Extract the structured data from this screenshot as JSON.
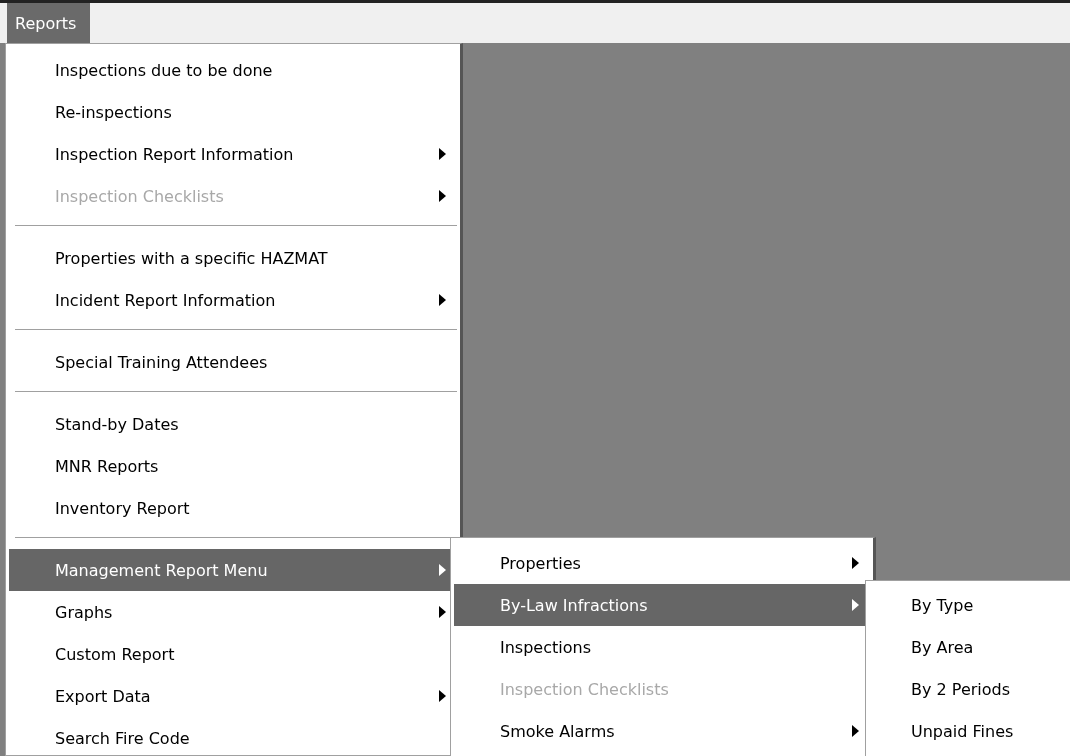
{
  "menu_bar": [
    {
      "label": "Reports",
      "selected": true
    }
  ],
  "main_menu": [
    {
      "kind": "item",
      "label": "Inspections due to be done",
      "submenu": false,
      "disabled": false,
      "selected": false
    },
    {
      "kind": "item",
      "label": "Re-inspections",
      "submenu": false,
      "disabled": false,
      "selected": false
    },
    {
      "kind": "item",
      "label": "Inspection Report Information",
      "submenu": true,
      "disabled": false,
      "selected": false
    },
    {
      "kind": "item",
      "label": "Inspection Checklists",
      "submenu": true,
      "disabled": true,
      "selected": false
    },
    {
      "kind": "separator"
    },
    {
      "kind": "item",
      "label": "Properties with a specific HAZMAT",
      "submenu": false,
      "disabled": false,
      "selected": false
    },
    {
      "kind": "item",
      "label": "Incident Report Information",
      "submenu": true,
      "disabled": false,
      "selected": false
    },
    {
      "kind": "separator"
    },
    {
      "kind": "item",
      "label": "Special Training Attendees",
      "submenu": false,
      "disabled": false,
      "selected": false
    },
    {
      "kind": "separator"
    },
    {
      "kind": "item",
      "label": "Stand-by Dates",
      "submenu": false,
      "disabled": false,
      "selected": false
    },
    {
      "kind": "item",
      "label": "MNR Reports",
      "submenu": false,
      "disabled": false,
      "selected": false
    },
    {
      "kind": "item",
      "label": "Inventory Report",
      "submenu": false,
      "disabled": false,
      "selected": false
    },
    {
      "kind": "separator"
    },
    {
      "kind": "item",
      "label": "Management Report Menu",
      "submenu": true,
      "disabled": false,
      "selected": true
    },
    {
      "kind": "item",
      "label": "Graphs",
      "submenu": true,
      "disabled": false,
      "selected": false
    },
    {
      "kind": "item",
      "label": "Custom Report",
      "submenu": false,
      "disabled": false,
      "selected": false
    },
    {
      "kind": "item",
      "label": "Export Data",
      "submenu": true,
      "disabled": false,
      "selected": false
    },
    {
      "kind": "item",
      "label": "Search Fire Code",
      "submenu": false,
      "disabled": false,
      "selected": false
    }
  ],
  "management_submenu": [
    {
      "kind": "item",
      "label": "Properties",
      "submenu": true,
      "disabled": false,
      "selected": false
    },
    {
      "kind": "item",
      "label": "By-Law Infractions",
      "submenu": true,
      "disabled": false,
      "selected": true
    },
    {
      "kind": "item",
      "label": "Inspections",
      "submenu": false,
      "disabled": false,
      "selected": false
    },
    {
      "kind": "item",
      "label": "Inspection Checklists",
      "submenu": false,
      "disabled": true,
      "selected": false
    },
    {
      "kind": "item",
      "label": "Smoke Alarms",
      "submenu": true,
      "disabled": false,
      "selected": false
    }
  ],
  "bylaw_submenu": [
    {
      "kind": "item",
      "label": "By Type",
      "submenu": false,
      "disabled": false,
      "selected": false
    },
    {
      "kind": "item",
      "label": "By Area",
      "submenu": false,
      "disabled": false,
      "selected": false
    },
    {
      "kind": "item",
      "label": "By 2 Periods",
      "submenu": false,
      "disabled": false,
      "selected": false
    },
    {
      "kind": "item",
      "label": "Unpaid Fines",
      "submenu": false,
      "disabled": false,
      "selected": false
    }
  ]
}
